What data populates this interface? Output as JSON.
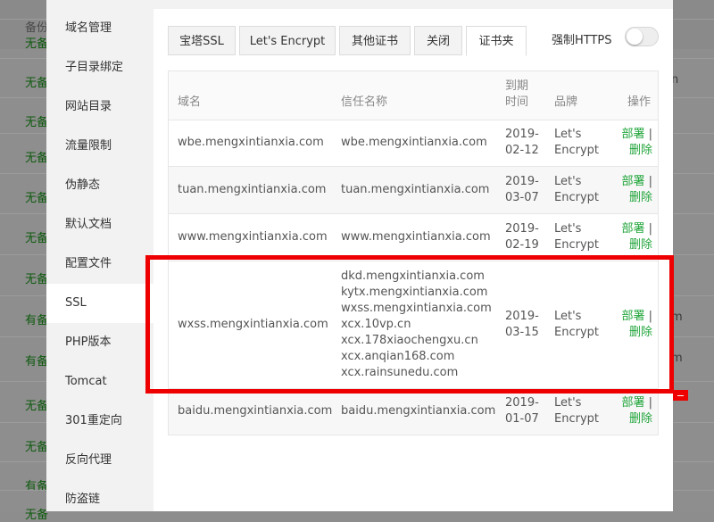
{
  "background": {
    "header_label": "备份",
    "rows": [
      {
        "status": "无备",
        "extra": ""
      },
      {
        "status": "无备",
        "extra": "n"
      },
      {
        "status": "无备",
        "extra": ""
      },
      {
        "status": "无备",
        "extra": ""
      },
      {
        "status": "无备",
        "extra": ""
      },
      {
        "status": "无备",
        "extra": ""
      },
      {
        "status": "无备",
        "extra": ""
      },
      {
        "status": "有备",
        "extra": "m"
      },
      {
        "status": "有备",
        "extra": "m"
      },
      {
        "status": "无备",
        "extra": ""
      },
      {
        "status": "无备",
        "extra": ""
      },
      {
        "status": "有备",
        "extra": ""
      },
      {
        "status": "无备",
        "extra": ""
      }
    ]
  },
  "sidebar": {
    "items": [
      {
        "label": "域名管理"
      },
      {
        "label": "子目录绑定"
      },
      {
        "label": "网站目录"
      },
      {
        "label": "流量限制"
      },
      {
        "label": "伪静态"
      },
      {
        "label": "默认文档"
      },
      {
        "label": "配置文件"
      },
      {
        "label": "SSL"
      },
      {
        "label": "PHP版本"
      },
      {
        "label": "Tomcat"
      },
      {
        "label": "301重定向"
      },
      {
        "label": "反向代理"
      },
      {
        "label": "防盗链"
      }
    ],
    "active_index": 7
  },
  "tabs": [
    {
      "label": "宝塔SSL"
    },
    {
      "label": "Let's Encrypt"
    },
    {
      "label": "其他证书"
    },
    {
      "label": "关闭"
    },
    {
      "label": "证书夹"
    }
  ],
  "force_https": {
    "label": "强制HTTPS",
    "enabled": false
  },
  "table": {
    "headers": {
      "domain": "域名",
      "trust": "信任名称",
      "expire_line1": "到期",
      "expire_line2": "时间",
      "brand": "品牌",
      "actions": "操作"
    },
    "rows": [
      {
        "domain": "wbe.mengxintianxia.com",
        "trust_names": [
          "wbe.mengxintianxia.com"
        ],
        "expire_line1": "2019-",
        "expire_line2": "02-12",
        "brand_line1": "Let's",
        "brand_line2": "Encrypt",
        "deploy": "部署",
        "sep": " |",
        "delete": "删除"
      },
      {
        "domain": "tuan.mengxintianxia.com",
        "trust_names": [
          "tuan.mengxintianxia.com"
        ],
        "expire_line1": "2019-",
        "expire_line2": "03-07",
        "brand_line1": "Let's",
        "brand_line2": "Encrypt",
        "deploy": "部署",
        "sep": " |",
        "delete": "删除"
      },
      {
        "domain": "www.mengxintianxia.com",
        "trust_names": [
          "www.mengxintianxia.com"
        ],
        "expire_line1": "2019-",
        "expire_line2": "02-19",
        "brand_line1": "Let's",
        "brand_line2": "Encrypt",
        "deploy": "部署",
        "sep": " |",
        "delete": "删除"
      },
      {
        "domain": "wxss.mengxintianxia.com",
        "trust_names": [
          "dkd.mengxintianxia.com",
          "kytx.mengxintianxia.com",
          "wxss.mengxintianxia.com",
          "xcx.10vp.cn",
          "xcx.178xiaochengxu.cn",
          "xcx.anqian168.com",
          "xcx.rainsunedu.com"
        ],
        "expire_line1": "2019-",
        "expire_line2": "03-15",
        "brand_line1": "Let's",
        "brand_line2": "Encrypt",
        "deploy": "部署",
        "sep": " |",
        "delete": "删除"
      },
      {
        "domain": "baidu.mengxintianxia.com",
        "trust_names": [
          "baidu.mengxintianxia.com"
        ],
        "expire_line1": "2019-",
        "expire_line2": "01-07",
        "brand_line1": "Let's",
        "brand_line2": "Encrypt",
        "deploy": "部署",
        "sep": " |",
        "delete": "删除"
      }
    ]
  },
  "colors": {
    "accent_green": "#20a53a",
    "highlight_red": "#ee0000"
  }
}
